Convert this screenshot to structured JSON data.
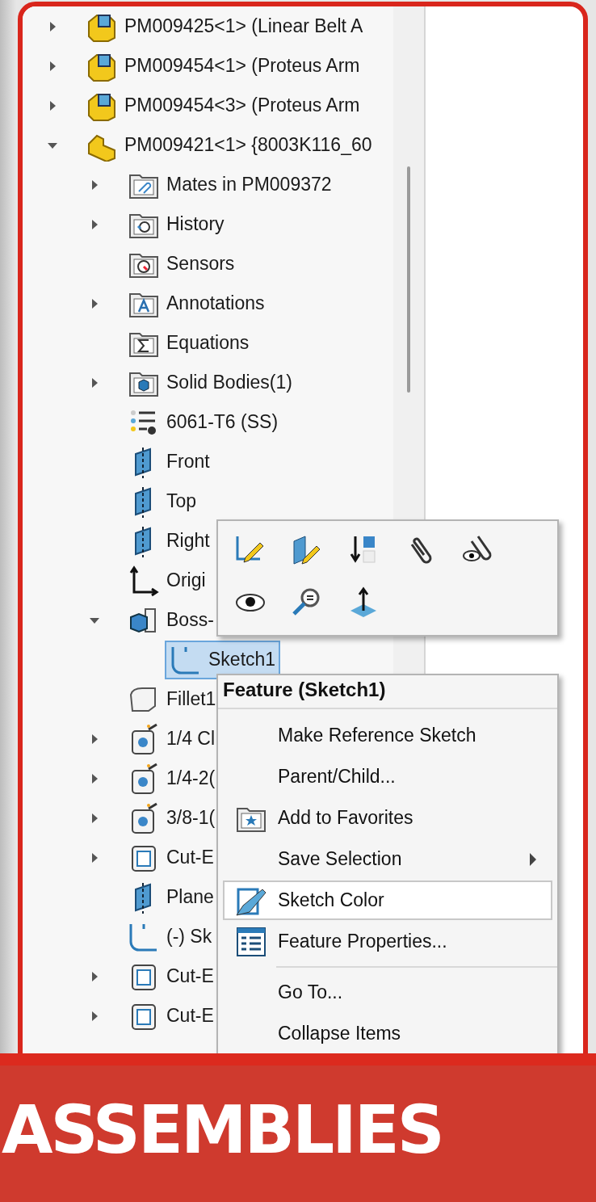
{
  "tree": [
    {
      "label": "PM009425<1> (Linear Belt A",
      "kind": "subassembly",
      "expanded": false
    },
    {
      "label": "PM009454<1> (Proteus Arm",
      "kind": "subassembly",
      "expanded": false
    },
    {
      "label": "PM009454<3> (Proteus Arm",
      "kind": "subassembly",
      "expanded": false
    },
    {
      "label": "PM009421<1> {8003K116_60",
      "kind": "part",
      "expanded": true,
      "children": [
        {
          "label": "Mates in PM009372",
          "kind": "folder-mates",
          "expanded": false
        },
        {
          "label": "History",
          "kind": "folder-history",
          "expanded": false
        },
        {
          "label": "Sensors",
          "kind": "folder-sensors"
        },
        {
          "label": "Annotations",
          "kind": "folder-annotations",
          "expanded": false
        },
        {
          "label": "Equations",
          "kind": "folder-equations"
        },
        {
          "label": "Solid Bodies(1)",
          "kind": "folder-bodies",
          "expanded": false
        },
        {
          "label": "6061-T6 (SS)",
          "kind": "material"
        },
        {
          "label": "Front",
          "kind": "plane"
        },
        {
          "label": "Top",
          "kind": "plane"
        },
        {
          "label": "Right",
          "kind": "plane"
        },
        {
          "label": "Origi",
          "kind": "origin"
        },
        {
          "label": "Boss-",
          "kind": "boss",
          "expanded": true,
          "children": [
            {
              "label": "Sketch1",
              "kind": "sketch",
              "selected": true
            }
          ]
        },
        {
          "label": "Fillet1",
          "kind": "fillet"
        },
        {
          "label": "1/4 Cl",
          "kind": "hole",
          "expanded": false
        },
        {
          "label": "1/4-2(",
          "kind": "hole",
          "expanded": false
        },
        {
          "label": "3/8-1(",
          "kind": "hole",
          "expanded": false
        },
        {
          "label": "Cut-E",
          "kind": "cut",
          "expanded": false
        },
        {
          "label": "Plane",
          "kind": "plane"
        },
        {
          "label": "(-) Sk",
          "kind": "sketch"
        },
        {
          "label": "Cut-E",
          "kind": "cut",
          "expanded": false
        },
        {
          "label": "Cut-E",
          "kind": "cut",
          "expanded": false
        }
      ]
    }
  ],
  "toolbar_buttons": [
    {
      "kind": "edit-sketch"
    },
    {
      "kind": "edit-plane"
    },
    {
      "kind": "rollback"
    },
    {
      "kind": "mates"
    },
    {
      "kind": "view-mates"
    },
    {
      "kind": "show"
    },
    {
      "kind": "zoom"
    },
    {
      "kind": "normal"
    }
  ],
  "context_menu": {
    "title": "Feature (Sketch1)",
    "items": [
      {
        "kind": "item",
        "label": "Make Reference Sketch",
        "hovered": false
      },
      {
        "kind": "item",
        "label": "Parent/Child...",
        "hovered": false
      },
      {
        "kind": "favorites",
        "label": "Add to Favorites",
        "hovered": false
      },
      {
        "kind": "item",
        "label": "Save Selection",
        "submenu": true,
        "hovered": false
      },
      {
        "kind": "sketch-color",
        "label": "Sketch Color",
        "hovered": true
      },
      {
        "kind": "properties",
        "label": "Feature Properties...",
        "hovered": false
      },
      {
        "kind": "separator"
      },
      {
        "kind": "item",
        "label": "Go To...",
        "hovered": false
      },
      {
        "kind": "item",
        "label": "Collapse Items",
        "hovered": false
      }
    ]
  },
  "banner": {
    "text": "ASSEMBLIES"
  }
}
